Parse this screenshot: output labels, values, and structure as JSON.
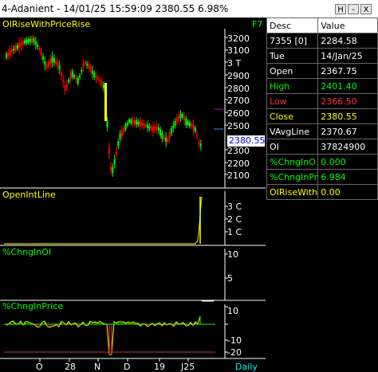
{
  "window": {
    "title": "4-Adanient - 14/01/25 15:59:09 2380.55 6.98%",
    "buttons": [
      "H",
      "-",
      "X"
    ]
  },
  "chart": {
    "price_panel_label": "OIRiseWithPriceRise",
    "f7": "F7",
    "price_ticks": [
      "3200",
      "3100",
      "3 T",
      "2900",
      "2800",
      "2700",
      "2600",
      "2500",
      "2300",
      "2200",
      "2100"
    ],
    "current_price": "2380.55",
    "oi_panel_label": "OpenIntLine",
    "oi_ticks": [
      "3 C",
      "2 C",
      "1 C"
    ],
    "chng_oi_label": "%ChngInOI",
    "chng_oi_ticks": [
      "10",
      "5"
    ],
    "chng_price_label": "%ChngInPrice",
    "chng_price_ticks": [
      "10",
      "-10",
      "-20"
    ],
    "x_ticks": [
      "O",
      "28",
      "N",
      "D",
      "19",
      "J25"
    ],
    "timeframe": "Daily",
    "colors": {
      "up": "#00ff00",
      "down": "#ff0000",
      "indicator": "#ffff00"
    }
  },
  "info_table": {
    "headers": [
      "Desc",
      "Value"
    ],
    "rows": [
      {
        "desc": "7355 [0]",
        "value": "2284.58",
        "color": "#ffffff"
      },
      {
        "desc": "Tue",
        "value": "14/Jan/25",
        "color": "#ffffff"
      },
      {
        "desc": "Open",
        "value": "2367.75",
        "color": "#ffffff"
      },
      {
        "desc": "High",
        "value": "2401.40",
        "color": "#00ff00"
      },
      {
        "desc": "Low",
        "value": "2366.50",
        "color": "#ff3333"
      },
      {
        "desc": "Close",
        "value": "2380.55",
        "color": "#ffff00"
      },
      {
        "desc": "VAvgLine",
        "value": "2370.67",
        "color": "#ffffff"
      },
      {
        "desc": "OI",
        "value": "37824900",
        "color": "#ffffff"
      },
      {
        "desc": "%ChngInO",
        "value": "0.000",
        "color": "#00ff00"
      },
      {
        "desc": "%ChngInPr",
        "value": "6.984",
        "color": "#00ff00"
      },
      {
        "desc": "OIRiseWith",
        "value": "0.00",
        "color": "#ffff00"
      }
    ]
  }
}
